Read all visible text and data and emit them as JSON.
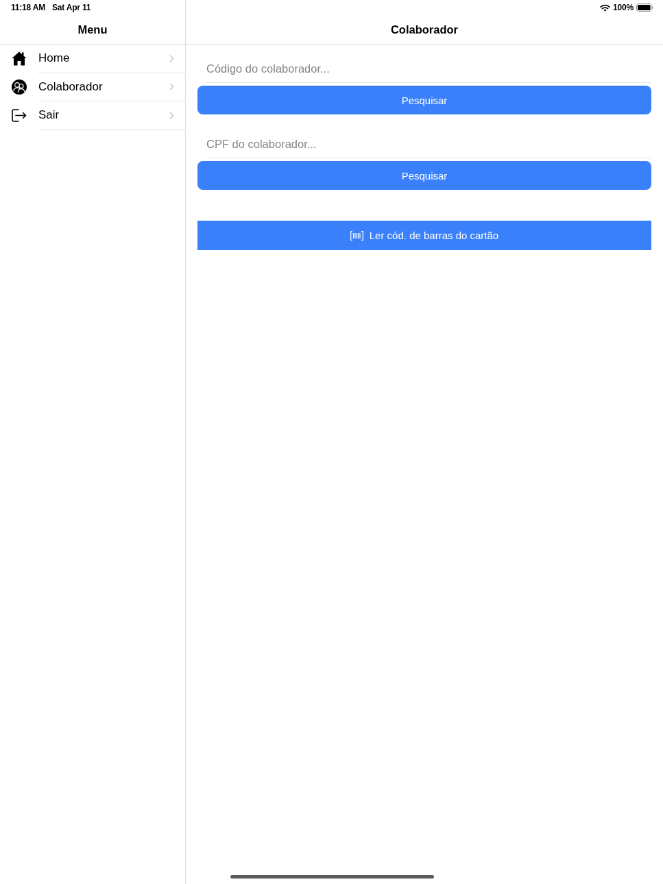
{
  "status_bar": {
    "time": "11:18 AM",
    "date": "Sat Apr 11",
    "battery": "100%"
  },
  "sidebar": {
    "title": "Menu",
    "items": [
      {
        "label": "Home",
        "kind": "home"
      },
      {
        "label": "Colaborador",
        "kind": "people"
      },
      {
        "label": "Sair",
        "kind": "exit"
      }
    ]
  },
  "main": {
    "title": "Colaborador",
    "searches": [
      {
        "placeholder": "Código do colaborador...",
        "button": "Pesquisar"
      },
      {
        "placeholder": "CPF do colaborador...",
        "button": "Pesquisar"
      }
    ],
    "scan_button": {
      "label": "Ler cód. de barras do cartão"
    }
  }
}
